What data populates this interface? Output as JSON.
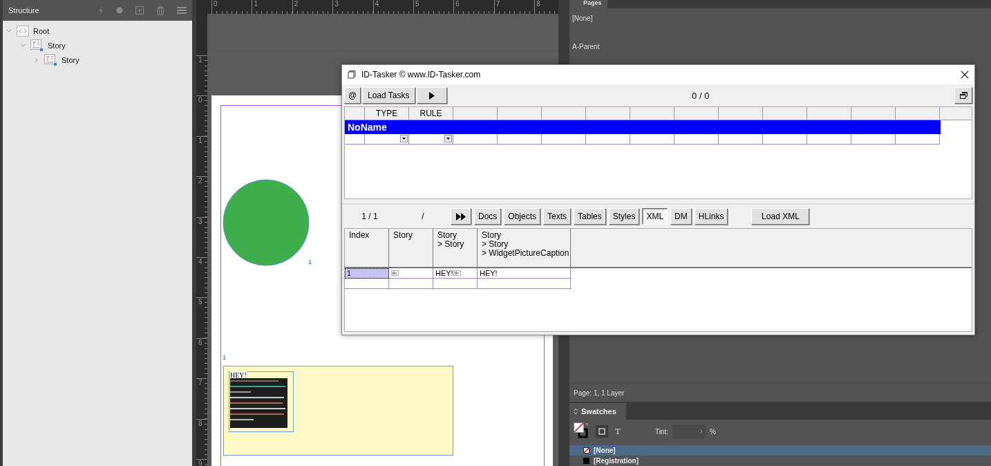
{
  "structure_panel": {
    "title": "Structure",
    "tree": [
      {
        "label": "Root",
        "kind": "root",
        "expanded": true,
        "children": [
          {
            "label": "Story",
            "kind": "story",
            "expanded": true,
            "children": [
              {
                "label": "Story",
                "kind": "story",
                "expanded": false
              }
            ]
          }
        ]
      }
    ]
  },
  "rulers": {
    "horizontal": [
      "0",
      "1",
      "2",
      "3",
      "4",
      "5",
      "6",
      "7",
      "8"
    ],
    "vertical": [
      "1",
      "0",
      "1",
      "2",
      "3",
      "4",
      "5",
      "6",
      "7",
      "8",
      "9"
    ]
  },
  "document": {
    "markers": [
      "1",
      "1"
    ],
    "text_frame": "HEY!"
  },
  "pages_panel": {
    "tab": "Pages",
    "items": [
      "[None]",
      "A-Parent"
    ],
    "status": "Page: 1, 1 Layer"
  },
  "swatches_panel": {
    "tab": "Swatches",
    "text_button": "T",
    "tint_label": "Tint:",
    "tint_unit": "%",
    "swatches": [
      {
        "name": "[None]",
        "kind": "none",
        "selected": true
      },
      {
        "name": "[Registration]",
        "kind": "registration",
        "selected": false
      }
    ]
  },
  "dialog": {
    "title": "ID-Tasker  © www.ID-Tasker.com",
    "at_button": "@",
    "load_tasks_button": "Load Tasks",
    "counter": "0 / 0",
    "task_columns": [
      "TYPE",
      "RULE"
    ],
    "group_row": "NoName",
    "position": "1 / 1",
    "separator": "/",
    "tabs": [
      {
        "label": "Docs",
        "selected": false
      },
      {
        "label": "Objects",
        "selected": false
      },
      {
        "label": "Texts",
        "selected": false
      },
      {
        "label": "Tables",
        "selected": false
      },
      {
        "label": "Styles",
        "selected": false
      },
      {
        "label": "XML",
        "selected": true
      },
      {
        "label": "DM",
        "selected": false
      },
      {
        "label": "HLinks",
        "selected": false
      }
    ],
    "load_xml_button": "Load XML",
    "xml_table": {
      "columns": [
        "Index",
        "Story",
        "Story\n> Story",
        "Story\n> Story\n> WidgetPictureCaption"
      ],
      "rows": [
        {
          "cells": [
            {
              "text": "1",
              "object_marker": false
            },
            {
              "object_marker": true
            },
            {
              "text": "HEY!",
              "object_marker": true
            },
            {
              "text": "HEY!",
              "object_marker": false
            }
          ],
          "selected": true
        }
      ]
    }
  }
}
